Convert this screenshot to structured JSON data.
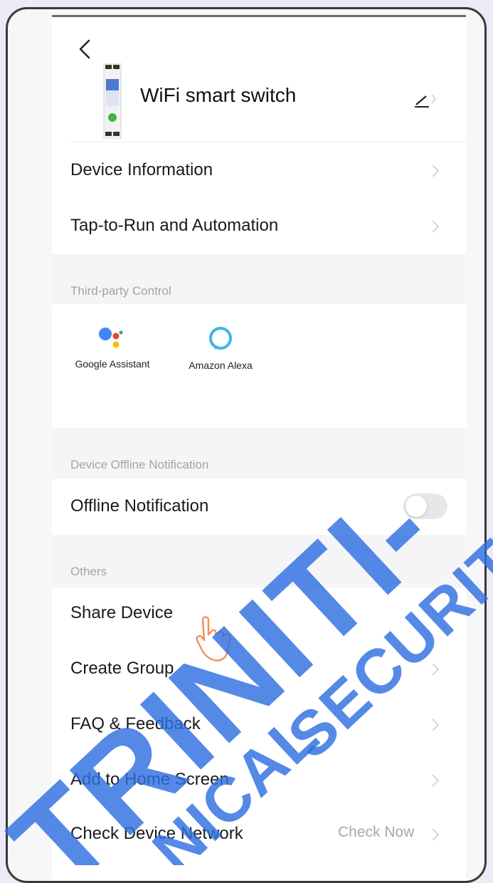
{
  "header": {
    "device_name": "WiFi smart switch"
  },
  "main_items": [
    {
      "label": "Device Information"
    },
    {
      "label": "Tap-to-Run and Automation"
    }
  ],
  "third_party": {
    "header": "Third-party Control",
    "items": [
      {
        "label": "Google Assistant",
        "icon": "google-assistant-icon"
      },
      {
        "label": "Amazon Alexa",
        "icon": "amazon-alexa-icon"
      }
    ]
  },
  "offline": {
    "header": "Device Offline Notification",
    "label": "Offline Notification",
    "enabled": false
  },
  "others": {
    "header": "Others",
    "items": [
      {
        "label": "Share Device"
      },
      {
        "label": "Create Group"
      },
      {
        "label": "FAQ & Feedback"
      },
      {
        "label": "Add to Home Screen"
      },
      {
        "label": "Check Device Network",
        "value": "Check Now"
      }
    ]
  },
  "watermark": {
    "line1": "TRINITI-",
    "line2": "SECURITY",
    "partial": "NICAL",
    "color": "#2f6fe0"
  },
  "colors": {
    "background": "#ffffff",
    "section_background": "#f5f5f7",
    "muted_text": "#a3a3a3"
  }
}
